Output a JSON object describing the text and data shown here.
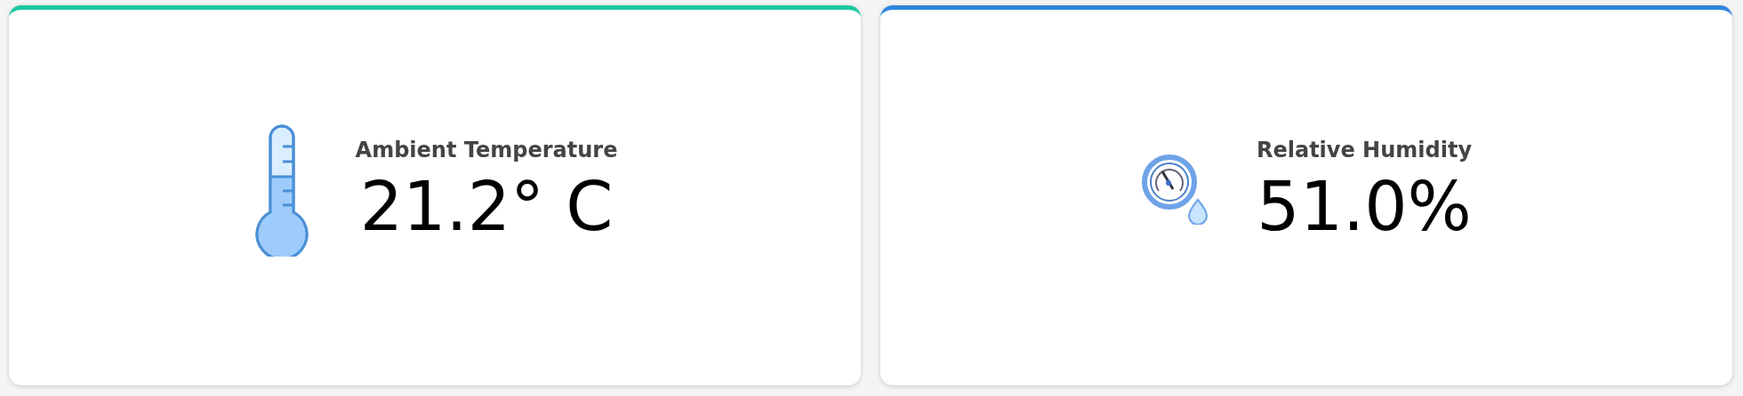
{
  "cards": [
    {
      "kind": "thermometer",
      "color": "#1cc8a0",
      "title": "Ambient Temperature",
      "value": "21.2° C"
    },
    {
      "kind": "hygrometer",
      "color": "#2e86de",
      "title": "Relative Humidity",
      "value": "51.0%"
    }
  ]
}
